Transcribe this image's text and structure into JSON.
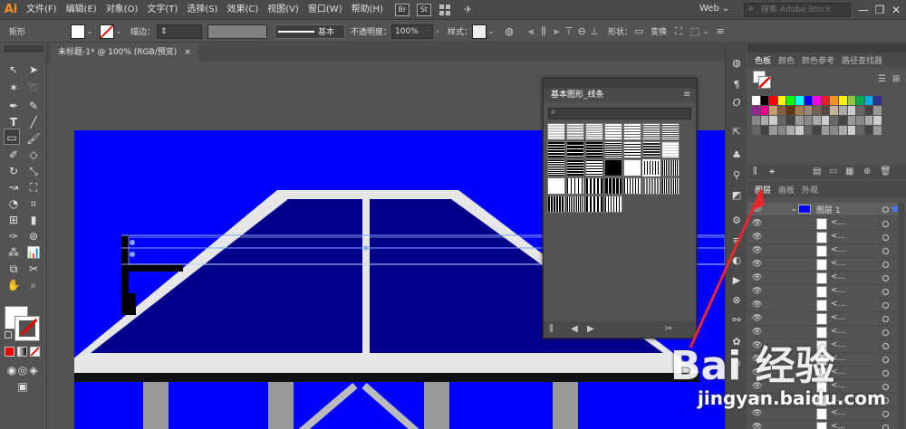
{
  "menubar": {
    "logo": "Ai",
    "items": [
      "文件(F)",
      "编辑(E)",
      "对象(O)",
      "文字(T)",
      "选择(S)",
      "效果(C)",
      "视图(V)",
      "窗口(W)",
      "帮助(H)"
    ],
    "br": "Br",
    "st": "St",
    "workspace": "Web",
    "search_placeholder": "搜索 Adobe Stock",
    "minimize": "—",
    "restore": "❐",
    "close": "✕"
  },
  "controlbar": {
    "tool_name": "矩形",
    "stroke_label": "描边：",
    "stroke_style": "基本",
    "opacity_label": "不透明度：",
    "opacity_value": "100%",
    "style_label": "样式：",
    "shape_label": "形状：",
    "transform_label": "变换"
  },
  "document_tab": {
    "label": "未标题-1* @ 100% (RGB/预览)",
    "close": "×"
  },
  "swatch_panel": {
    "title": "基本图形_线条"
  },
  "color_panel": {
    "tabs": [
      "色板",
      "颜色",
      "颜色参考",
      "路径查找器"
    ],
    "swatch_colors": [
      "#ffffff",
      "#000000",
      "#ff0000",
      "#ffff00",
      "#00ff00",
      "#00ffff",
      "#0000ff",
      "#ff00ff",
      "#ed1c24",
      "#f7941e",
      "#fff200",
      "#8dc63f",
      "#00a651",
      "#00aeef",
      "#2e3192",
      "#92278f",
      "#ec008c",
      "#c69c6d",
      "#8b5e3c",
      "#603913",
      "#a67c52",
      "#998675",
      "#736357",
      "#534741",
      "#c7b299"
    ]
  },
  "layers_panel": {
    "tabs": [
      "图层",
      "画板",
      "外观"
    ],
    "layer_name": "图层 1",
    "sublayer_label": "<...",
    "sublayer_count": 16
  },
  "watermark": {
    "brand": "Bai 经验",
    "url": "jingyan.baidu.com"
  },
  "colors": {
    "artboard_blue": "#0000ff",
    "table_navy": "#00008b",
    "accent_orange": "#f7941e",
    "annotation_red": "#e8262d"
  }
}
